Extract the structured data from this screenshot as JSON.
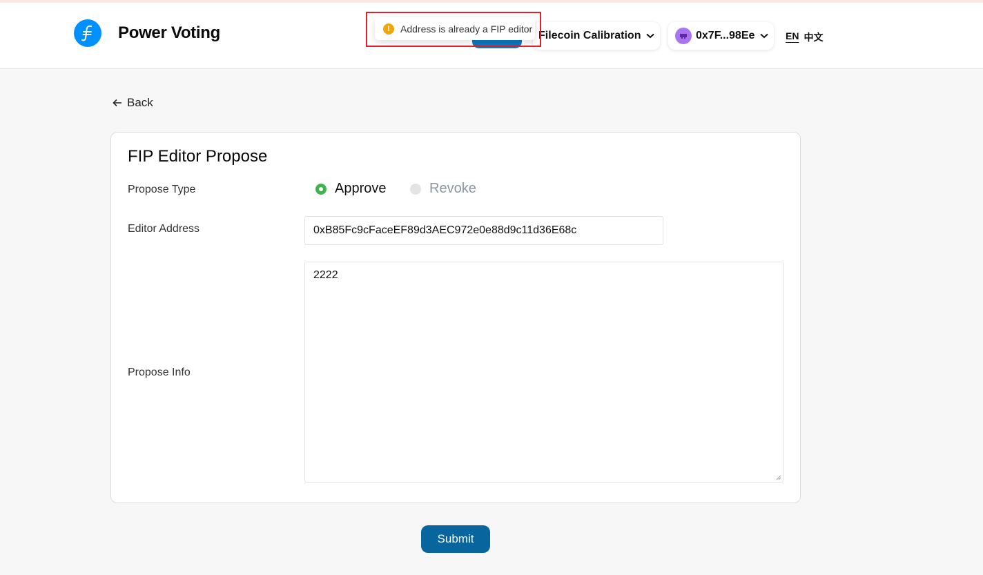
{
  "app": {
    "name": "Power Voting"
  },
  "header": {
    "network_label": "Filecoin Calibration",
    "account_label": "0x7F...98Ee",
    "lang_en": "EN",
    "lang_zh": "中文"
  },
  "toast": {
    "message": "Address is already a FIP editor"
  },
  "nav": {
    "back_label": "Back"
  },
  "form": {
    "title": "FIP Editor Propose",
    "propose_type_label": "Propose Type",
    "options": [
      {
        "label": "Approve",
        "selected": true
      },
      {
        "label": "Revoke",
        "selected": false
      }
    ],
    "editor_address_label": "Editor Address",
    "editor_address_value": "0xB85Fc9cFaceEF89d3AEC972e0e88d9c11d36E68c",
    "propose_info_label": "Propose Info",
    "propose_info_value": "2222",
    "submit_label": "Submit"
  },
  "colors": {
    "brand": "#0090ff",
    "submit": "#09659e",
    "radio_checked": "#3db54a",
    "warning": "#f2a60c",
    "highlight": "#e0202a"
  }
}
